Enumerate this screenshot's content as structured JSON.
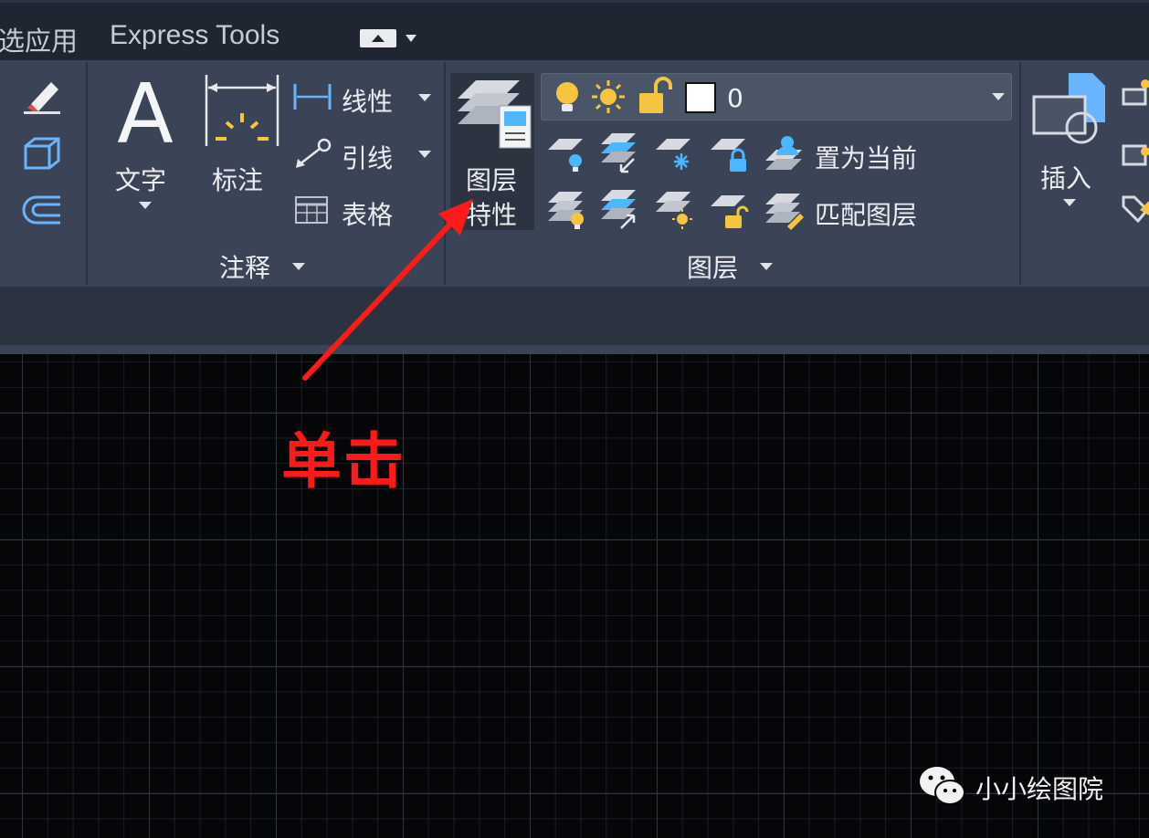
{
  "tabs": {
    "cut_label": "选应用",
    "express_label": "Express Tools"
  },
  "annotate_panel": {
    "text_label": "文字",
    "dimension_label": "标注",
    "linear_label": "线性",
    "leader_label": "引线",
    "table_label": "表格",
    "title": "注释"
  },
  "layers_panel": {
    "properties_line1": "图层",
    "properties_line2": "特性",
    "current_layer": "0",
    "set_current_label": "置为当前",
    "match_layer_label": "匹配图层",
    "title": "图层"
  },
  "block_panel": {
    "insert_label": "插入"
  },
  "annotation": {
    "text": "单击"
  },
  "watermark": {
    "text": "小小绘图院"
  },
  "colors": {
    "ribbon": "#3a4456",
    "tabbar": "#1f2632",
    "annotation_red": "#ff1a1a",
    "icon_yellow": "#f5c542",
    "icon_blue": "#4db6ff"
  }
}
